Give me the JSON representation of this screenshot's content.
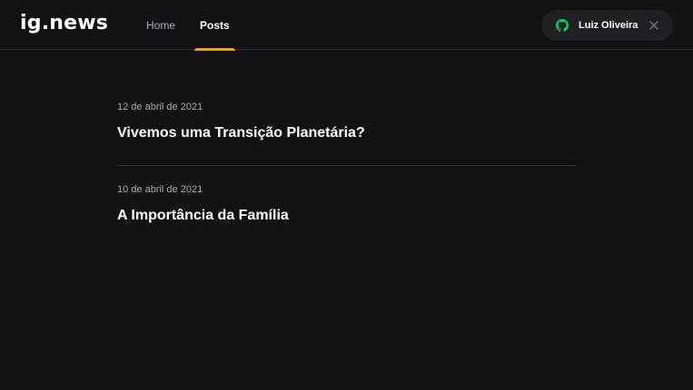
{
  "header": {
    "logo": "ig.news",
    "nav": [
      {
        "label": "Home",
        "active": false
      },
      {
        "label": "Posts",
        "active": true
      }
    ],
    "user": {
      "name": "Luiz Oliveira",
      "icon": "github-icon",
      "icon_color": "#04d361",
      "close_icon": "close-icon"
    }
  },
  "posts": [
    {
      "date": "12 de abril de 2021",
      "title": "Vivemos uma Transição Planetária?"
    },
    {
      "date": "10 de abril de 2021",
      "title": "A Importância da Família"
    }
  ],
  "colors": {
    "background": "#121214",
    "active_underline": "#eba417",
    "pill_background": "#202024"
  }
}
